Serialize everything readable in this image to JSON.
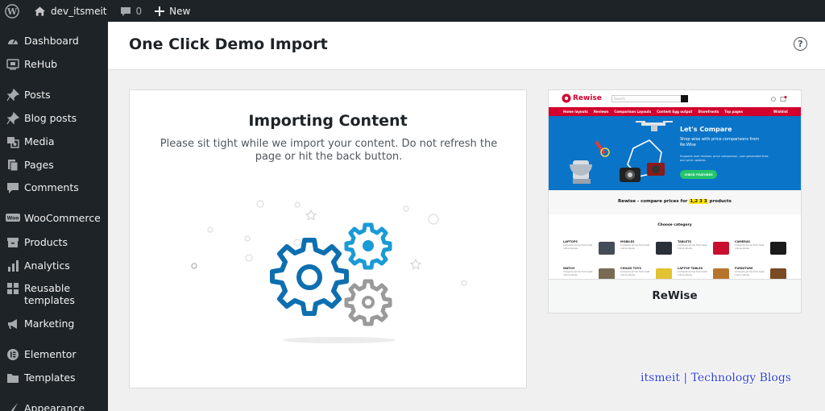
{
  "adminbar": {
    "site_name": "dev_itsmeit",
    "comments_count": "0",
    "new_label": "New"
  },
  "sidebar": {
    "items": [
      {
        "label": "Dashboard",
        "icon": "dashboard-icon"
      },
      {
        "label": "ReHub",
        "icon": "rehub-icon"
      },
      {
        "label": "Posts",
        "icon": "pin-icon"
      },
      {
        "label": "Blog posts",
        "icon": "pin-icon"
      },
      {
        "label": "Media",
        "icon": "media-icon"
      },
      {
        "label": "Pages",
        "icon": "pages-icon"
      },
      {
        "label": "Comments",
        "icon": "comment-icon"
      },
      {
        "label": "WooCommerce",
        "icon": "woocommerce-icon"
      },
      {
        "label": "Products",
        "icon": "archive-icon"
      },
      {
        "label": "Analytics",
        "icon": "bar-chart-icon"
      },
      {
        "label": "Reusable templates",
        "icon": "grid-icon"
      },
      {
        "label": "Marketing",
        "icon": "megaphone-icon"
      },
      {
        "label": "Elementor",
        "icon": "elementor-icon"
      },
      {
        "label": "Templates",
        "icon": "folder-icon"
      },
      {
        "label": "Appearance",
        "icon": "brush-icon"
      }
    ]
  },
  "header": {
    "title": "One Click Demo Import",
    "help_label": "?"
  },
  "import": {
    "title": "Importing Content",
    "description": "Please sit tight while we import your content. Do not refresh the page or hit the back button."
  },
  "demo": {
    "name": "ReWise",
    "preview": {
      "logo": "Rewise",
      "search_placeholder": "Search",
      "wishlist": "Wishlist",
      "nav": [
        "Home layouts",
        "Reviews",
        "Comparison Layouts",
        "Content Egg output",
        "Storefronts",
        "Top pages"
      ],
      "hero_title": "Let's Compare",
      "hero_subtitle": "Shop wise with price comparisons from Re:Wise",
      "hero_small": "Supports user reviews, price comparison, user generated links and price updates",
      "hero_button": "CHECK FEATURES",
      "strip_prefix": "Rewise - compare prices for",
      "strip_highlight": "1,2 3 3",
      "strip_suffix": "products",
      "category_title": "Choose category",
      "categories": [
        {
          "name": "LAPTOPS",
          "desc": "Compare prices from best online stores",
          "color": "#444c58"
        },
        {
          "name": "MOBILES",
          "desc": "Compare prices from best online stores",
          "color": "#2a2f3a"
        },
        {
          "name": "TABLETS",
          "desc": "Compare prices from best online stores",
          "color": "#c8102e"
        },
        {
          "name": "CAMERAS",
          "desc": "Compare prices from best online stores",
          "color": "#1a1a1a"
        },
        {
          "name": "WATCH",
          "desc": "Compare prices from best online stores",
          "color": "#7a6a55"
        },
        {
          "name": "CHILDS TOYS",
          "desc": "Compare prices from best online stores",
          "color": "#e2c331"
        },
        {
          "name": "LAPTOP TABLES",
          "desc": "Compare prices from best online stores",
          "color": "#b8742e"
        },
        {
          "name": "FURNITURE",
          "desc": "Compare prices from best online stores",
          "color": "#7a4a22"
        }
      ]
    }
  },
  "watermark": "itsmeit | Technology Blogs",
  "colors": {
    "adminbar_bg": "#1d2327",
    "gear_blue": "#0e6fb0",
    "gear_gray": "#9a9a9a",
    "page_bg": "#f0f0f1"
  }
}
